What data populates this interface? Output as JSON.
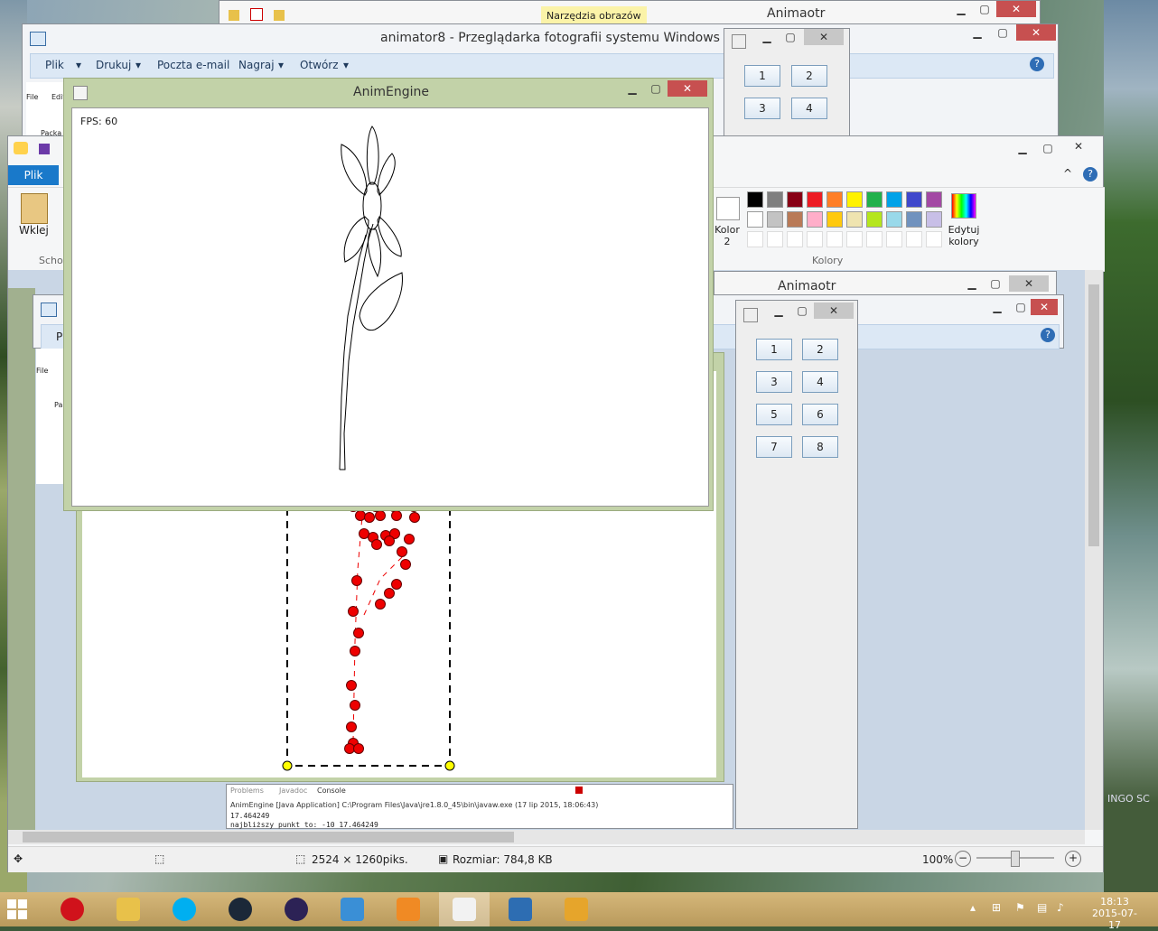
{
  "windows": {
    "explorer_top": {
      "tab": "Narzędzia obrazów",
      "title": "Animaotr"
    },
    "photo_viewer": {
      "title": "animator8 - Przeglądarka fotografii systemu Windows",
      "menu": [
        "Plik",
        "Drukuj",
        "Poczta e-mail",
        "Nagraj",
        "Otwórz"
      ],
      "side": [
        "File",
        "Edit"
      ],
      "tree_item": "Packa"
    },
    "animator_small_top": {
      "buttons": [
        "1",
        "2",
        "3",
        "4"
      ]
    },
    "paint": {
      "file_tab": "Plik",
      "paste_label": "Wklej",
      "clipboard_group": "Schow",
      "color2_label": "Kolor 2",
      "edit_colors": "Edytuj kolory",
      "colors_group": "Kolory",
      "palette_row1": [
        "#000000",
        "#7f7f7f",
        "#880015",
        "#ed1c24",
        "#ff7f27",
        "#fff200",
        "#22b14c",
        "#00a2e8",
        "#3f48cc",
        "#a349a4"
      ],
      "palette_row2": [
        "#ffffff",
        "#c3c3c3",
        "#b97a57",
        "#ffaec9",
        "#ffc90e",
        "#efe4b0",
        "#b5e61d",
        "#99d9ea",
        "#7092be",
        "#c8bfe7"
      ],
      "zoom": "100%",
      "size_px": "2524 × 1260piks.",
      "file_size": "Rozmiar: 784,8 KB"
    },
    "animaotr_mid": {
      "title": "Animaotr"
    },
    "animator_panel": {
      "buttons": [
        "1",
        "2",
        "3",
        "4",
        "5",
        "6",
        "7",
        "8"
      ]
    },
    "animengine": {
      "title": "AnimEngine",
      "fps": "FPS: 60"
    },
    "eclipse_console": {
      "tabs": [
        "Problems",
        "Javadoc",
        "Console"
      ],
      "line1": "AnimEngine [Java Application] C:\\Program Files\\Java\\jre1.8.0_45\\bin\\javaw.exe (17 lip 2015, 18:06:43)",
      "line2": "17.464249",
      "line3": "najbliższy punkt to: -10 17.464249"
    },
    "left_fragments": {
      "pl": "Pl",
      "file": "File",
      "pa": "Pa"
    }
  },
  "taskbar": {
    "time": "18:13",
    "date": "2015-07-17",
    "apps": [
      "opera-icon",
      "explorer-icon",
      "skype-icon",
      "steam-icon",
      "eclipse-icon",
      "control-panel-icon",
      "media-player-icon",
      "java-icon",
      "photo-viewer-icon",
      "paint-icon"
    ]
  },
  "watermark": "INGO SC"
}
